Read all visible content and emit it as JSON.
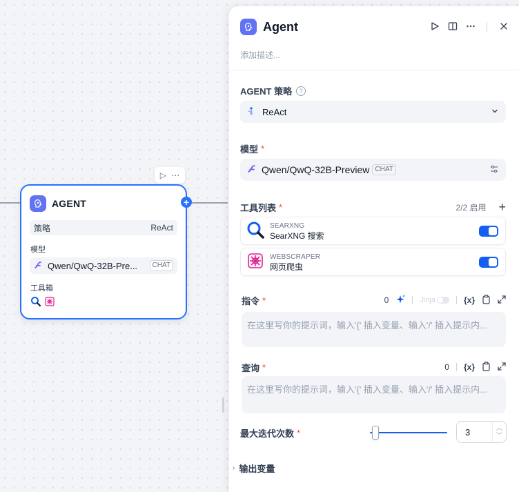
{
  "node": {
    "title": "AGENT",
    "strategy_label": "策略",
    "strategy_value": "ReAct",
    "model_label": "模型",
    "model_name": "Qwen/QwQ-32B-Pre...",
    "model_badge": "CHAT",
    "tools_label": "工具箱",
    "tools": [
      "search-icon",
      "webscraper-icon"
    ]
  },
  "panel": {
    "title": "Agent",
    "description_placeholder": "添加描述...",
    "strategy": {
      "label": "AGENT 策略",
      "value": "ReAct"
    },
    "model": {
      "label": "模型",
      "required": "*",
      "name": "Qwen/QwQ-32B-Preview",
      "badge": "CHAT"
    },
    "tools": {
      "label": "工具列表",
      "required": "*",
      "count": "2/2 启用",
      "add": "+",
      "items": [
        {
          "provider": "SEARXNG",
          "name": "SearXNG 搜索",
          "enabled": true,
          "icon": "searxng-icon"
        },
        {
          "provider": "WEBSCRAPER",
          "name": "网页爬虫",
          "enabled": true,
          "icon": "webscraper-icon"
        }
      ]
    },
    "instruction": {
      "label": "指令",
      "required": "*",
      "count": "0",
      "jinja": "Jinja",
      "var_icon": "{x}",
      "placeholder": "在这里写你的提示词，输入'{' 插入变量、输入'/' 插入提示内..."
    },
    "query": {
      "label": "查询",
      "required": "*",
      "count": "0",
      "var_icon": "{x}",
      "placeholder": "在这里写你的提示词，输入'{' 插入变量、输入'/' 插入提示内..."
    },
    "max_iterations": {
      "label": "最大迭代次数",
      "required": "*",
      "value": "3",
      "slider_fraction": 0.02
    },
    "output_vars": {
      "label": "输出变量"
    }
  },
  "colors": {
    "accent": "#155eef",
    "node_border": "#2970ff",
    "agent_icon_bg": "#6172f3",
    "required": "#f04438",
    "webscraper": "#dd2590"
  }
}
